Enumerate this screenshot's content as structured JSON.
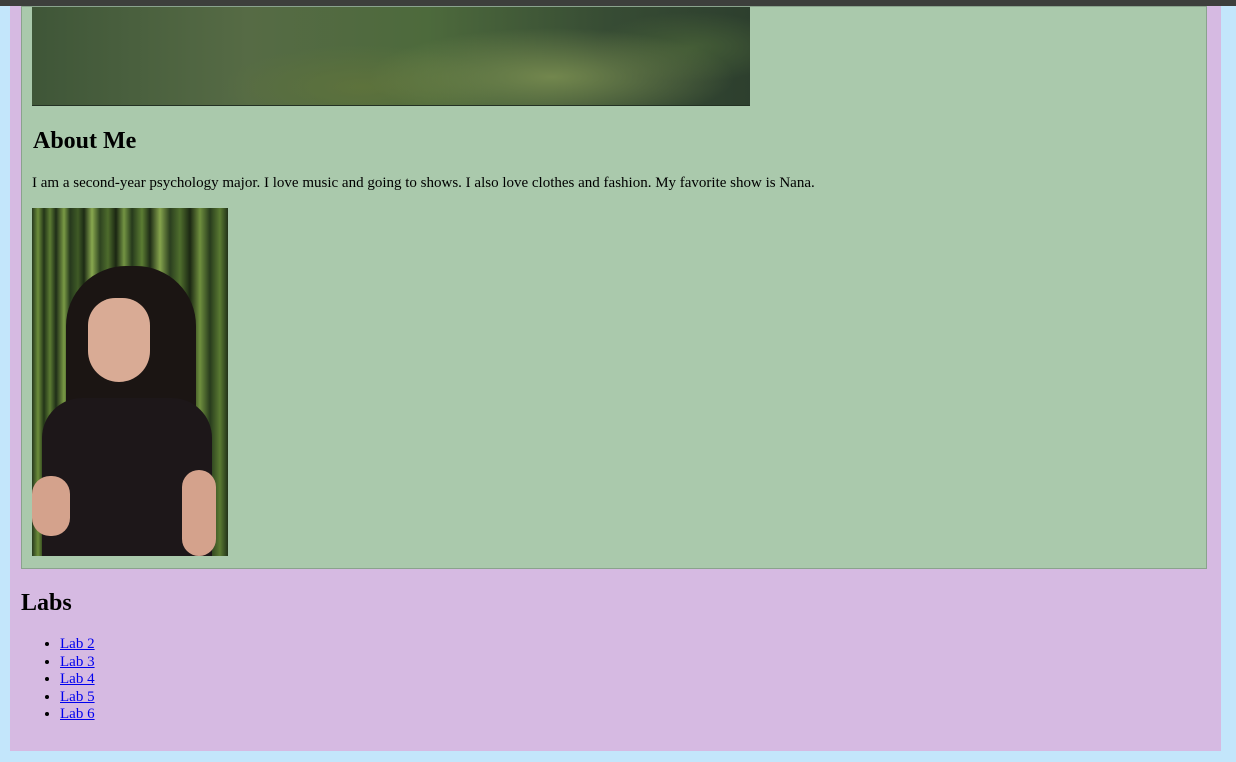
{
  "about": {
    "heading": "About Me",
    "text": "I am a second-year psychology major. I love music and going to shows. I also love clothes and fashion. My favorite show is Nana."
  },
  "labs": {
    "heading": "Labs",
    "items": [
      {
        "label": "Lab 2"
      },
      {
        "label": "Lab 3"
      },
      {
        "label": "Lab 4"
      },
      {
        "label": "Lab 5"
      },
      {
        "label": "Lab 6"
      }
    ]
  },
  "colors": {
    "outer_background": "#c3e6fb",
    "page_background": "#d6bae2",
    "about_section_background": "#aac9ac",
    "link": "#0000ee"
  }
}
